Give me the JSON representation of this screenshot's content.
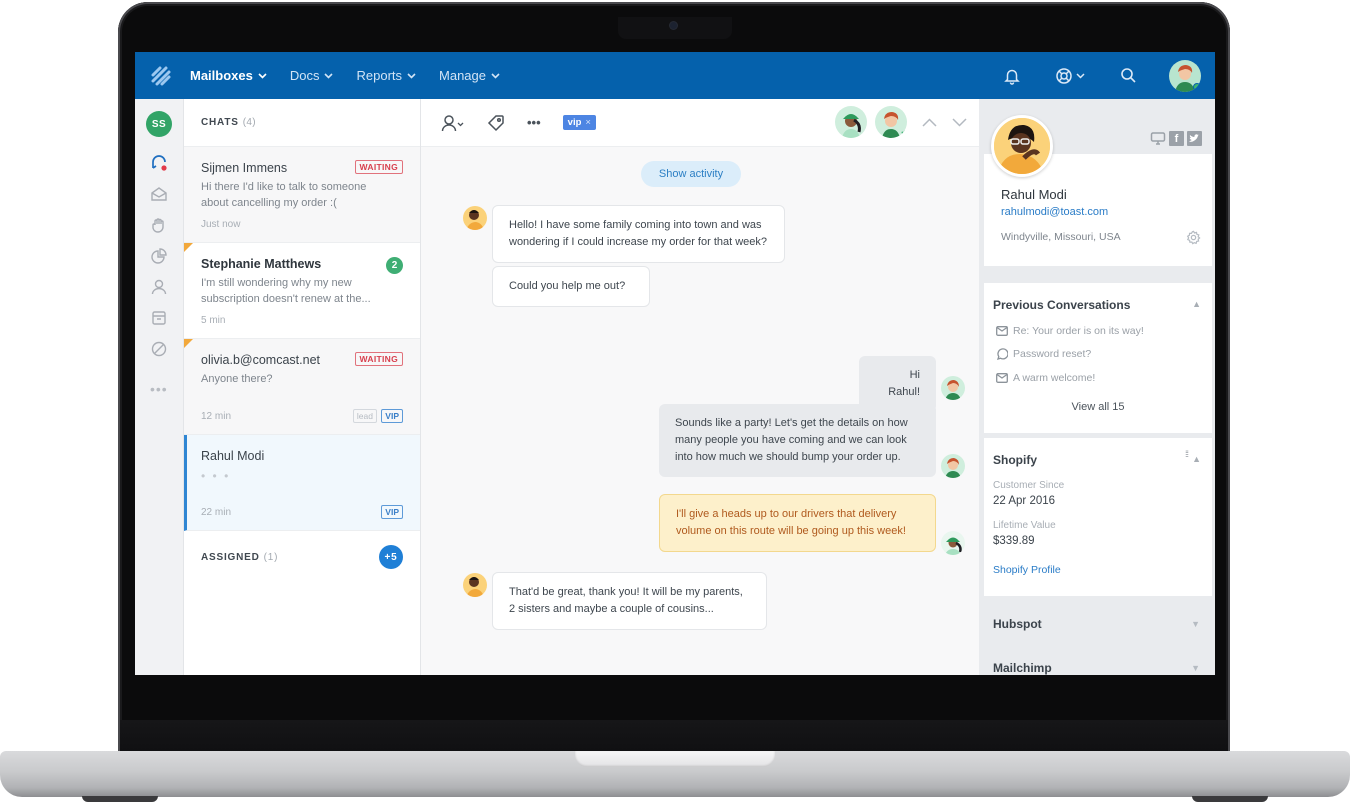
{
  "nav": {
    "items": [
      {
        "label": "Mailboxes",
        "active": true
      },
      {
        "label": "Docs",
        "active": false
      },
      {
        "label": "Reports",
        "active": false
      },
      {
        "label": "Manage",
        "active": false
      }
    ],
    "icons": [
      "bell-icon",
      "help-lifebuoy-icon",
      "search-icon",
      "user-avatar"
    ],
    "brand_color": "#0561ac"
  },
  "rail": {
    "user_initials": "SS",
    "icons": [
      "chat-icon",
      "open-mail-icon",
      "hand-icon",
      "pie-chart-icon",
      "person-icon",
      "archive-icon",
      "blocked-icon",
      "more-icon"
    ]
  },
  "chats": {
    "header": "CHATS",
    "count": "(4)",
    "items": [
      {
        "name": "Sijmen Immens",
        "preview": "Hi there I'd like to talk to someone about cancelling my order :(",
        "time": "Just now",
        "badge": "WAITING"
      },
      {
        "name": "Stephanie Matthews",
        "preview": "I'm still wondering why my new subscription doesn't renew at the...",
        "time": "5 min",
        "unread": "2"
      },
      {
        "name": "olivia.b@comcast.net",
        "preview": "Anyone there?",
        "time": "12 min",
        "badge": "WAITING",
        "tags": [
          "lead",
          "VIP"
        ]
      },
      {
        "name": "Rahul Modi",
        "preview": "• • •",
        "time": "22 min",
        "tags": [
          "VIP"
        ]
      }
    ],
    "assigned_header": "ASSIGNED",
    "assigned_count": "(1)",
    "assigned_badge": "+5"
  },
  "conversation": {
    "toolbar": {
      "tag_label": "vip",
      "tag_remove": "×"
    },
    "show_activity": "Show activity",
    "messages": [
      {
        "from": "customer",
        "text": "Hello! I have some family coming into town and was wondering if I could increase my order for that week?"
      },
      {
        "from": "customer",
        "text": "Could you help me out?"
      },
      {
        "from": "agent",
        "text": "Hi Rahul!"
      },
      {
        "from": "agent",
        "text": "Sounds like a party! Let's get the details on how many people you have coming and we can look into how much we should bump your order up."
      },
      {
        "from": "agent-note",
        "text": "I'll give a heads up to our drivers that delivery volume on this route will be going up this week!"
      },
      {
        "from": "customer",
        "text": "That'd be great, thank you!  It will be my parents, 2 sisters and maybe a couple of cousins..."
      }
    ]
  },
  "profile": {
    "name": "Rahul Modi",
    "email": "rahulmodi@toast.com",
    "location": "Windyville, Missouri, USA",
    "social": [
      "device-icon",
      "f",
      "t"
    ]
  },
  "previous_conversations": {
    "title": "Previous Conversations",
    "items": [
      {
        "icon": "mail-icon",
        "label": "Re: Your order is on its way!"
      },
      {
        "icon": "chat-bubble-icon",
        "label": "Password reset?"
      },
      {
        "icon": "mail-icon",
        "label": "A warm welcome!"
      }
    ],
    "view_all": "View all 15"
  },
  "shopify": {
    "title": "Shopify",
    "customer_since_label": "Customer Since",
    "customer_since": "22 Apr 2016",
    "lifetime_value_label": "Lifetime Value",
    "lifetime_value": "$339.89",
    "profile_link": "Shopify Profile"
  },
  "integrations": [
    {
      "title": "Hubspot"
    },
    {
      "title": "Mailchimp"
    }
  ]
}
